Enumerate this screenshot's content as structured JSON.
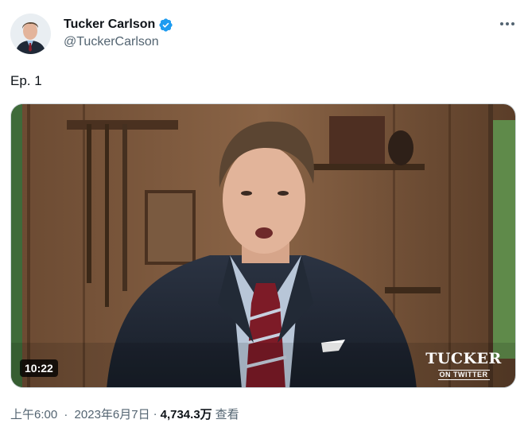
{
  "author": {
    "display_name": "Tucker Carlson",
    "handle": "@TuckerCarlson",
    "verified_icon": "verified-badge-icon",
    "avatar_icon": "avatar"
  },
  "more_icon": "more-options-icon",
  "tweet": {
    "text": "Ep. 1"
  },
  "media": {
    "type": "video",
    "duration": "10:22",
    "brand_title": "TUCKER",
    "brand_subtitle": "ON TWITTER"
  },
  "meta": {
    "time": "上午6:00",
    "separator": "·",
    "date": "2023年6月7日",
    "views_count": "4,734.3万",
    "views_label": "查看"
  },
  "colors": {
    "primary_text": "#0f1419",
    "secondary_text": "#536471",
    "verified_blue": "#1d9bf0"
  }
}
